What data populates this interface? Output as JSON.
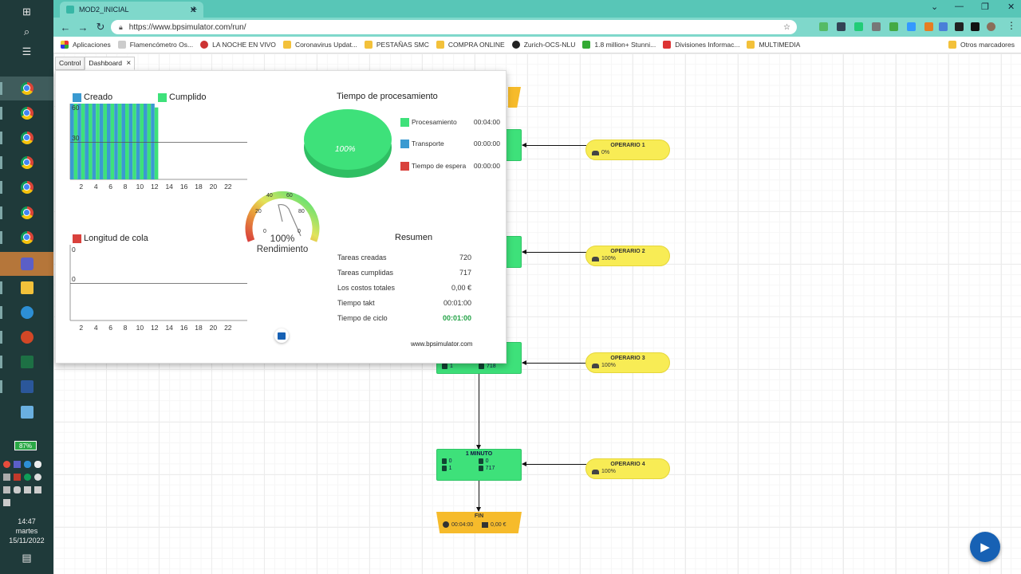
{
  "browser": {
    "tab_title": "MOD2_INICIAL",
    "url": "https://www.bpsimulator.com/run/",
    "bookmarks": [
      "Aplicaciones",
      "Flamencómetro Os...",
      "LA NOCHE EN VIVO",
      "Coronavirus Updat...",
      "PESTAÑAS SMC",
      "COMPRA ONLINE",
      "Zurich-OCS-NLU",
      "1.8 million+ Stunni...",
      "Divisiones Informac...",
      "MULTIMEDIA"
    ],
    "other_bookmarks": "Otros marcadores"
  },
  "taskbar": {
    "battery": "87%",
    "time": "14:47",
    "day": "martes",
    "date": "15/11/2022"
  },
  "dashboard": {
    "tabs": [
      "Control",
      "Dashboard"
    ],
    "close_glyph": "×",
    "tasks_chart": {
      "legend": [
        "Creado",
        "Cumplido"
      ],
      "y_ticks": [
        "60",
        "30"
      ],
      "x_ticks": [
        "2",
        "4",
        "6",
        "8",
        "10",
        "12",
        "14",
        "16",
        "18",
        "20",
        "22"
      ]
    },
    "queue_chart": {
      "legend": [
        "Longitud de cola"
      ],
      "y_ticks": [
        "0",
        "0"
      ],
      "x_ticks": [
        "2",
        "4",
        "6",
        "8",
        "10",
        "12",
        "14",
        "16",
        "18",
        "20",
        "22"
      ]
    },
    "gauge": {
      "ticks": [
        "0",
        "20",
        "40",
        "60",
        "80",
        "0"
      ],
      "value_text": "100%",
      "label": "Rendimiento"
    },
    "pie": {
      "title": "Tiempo de procesamiento",
      "center_label": "100%",
      "legend": [
        {
          "name": "Procesamiento",
          "value": "00:04:00",
          "color": "#3ee17a"
        },
        {
          "name": "Transporte",
          "value": "00:00:00",
          "color": "#3a9ad1"
        },
        {
          "name": "Tiempo de espera",
          "value": "00:00:00",
          "color": "#d9413c"
        }
      ]
    },
    "summary": {
      "title": "Resumen",
      "rows": [
        {
          "label": "Tareas creadas",
          "value": "720"
        },
        {
          "label": "Tareas cumplidas",
          "value": "717"
        },
        {
          "label": "Los costos totales",
          "value": "0,00 €"
        },
        {
          "label": "Tiempo takt",
          "value": "00:01:00"
        },
        {
          "label": "Tiempo de ciclo",
          "value": "00:01:00"
        }
      ]
    },
    "footer": "www.bpsimulator.com"
  },
  "diagram": {
    "operators": [
      {
        "name": "OPERARIO 1",
        "value": "0%"
      },
      {
        "name": "OPERARIO 2",
        "value": "100%"
      },
      {
        "name": "OPERARIO 3",
        "value": "100%"
      },
      {
        "name": "OPERARIO 4",
        "value": "100%"
      }
    ],
    "process3": {
      "v1": "1",
      "v2": "718"
    },
    "process4": {
      "title": "1 MINUTO",
      "v1": "0",
      "v2": "0",
      "v3": "1",
      "v4": "717"
    },
    "fin": {
      "title": "FIN",
      "time": "00:04:00",
      "cost": "0,00 €"
    }
  },
  "chart_data": [
    {
      "type": "bar",
      "categories": [
        "1",
        "2",
        "3",
        "4",
        "5",
        "6",
        "7",
        "8",
        "9",
        "10",
        "11",
        "12"
      ],
      "series": [
        {
          "name": "Creado",
          "values": [
            60,
            60,
            60,
            60,
            60,
            60,
            60,
            60,
            60,
            60,
            60,
            60
          ]
        },
        {
          "name": "Cumplido",
          "values": [
            60,
            60,
            60,
            60,
            60,
            60,
            60,
            60,
            60,
            60,
            60,
            57
          ]
        }
      ],
      "ylim": [
        0,
        60
      ],
      "legend": "top-left"
    },
    {
      "type": "line",
      "x": [
        1,
        2,
        3,
        4,
        5,
        6,
        7,
        8,
        9,
        10,
        11,
        12
      ],
      "series": [
        {
          "name": "Longitud de cola",
          "values": [
            0,
            0,
            0,
            0,
            0,
            0,
            0,
            0,
            0,
            0,
            0,
            0
          ]
        }
      ],
      "legend": "top-left"
    },
    {
      "type": "pie",
      "categories": [
        "Procesamiento",
        "Transporte",
        "Tiempo de espera"
      ],
      "values": [
        100,
        0,
        0
      ]
    }
  ],
  "colors": {
    "accent": "#58c6b7",
    "created": "#3a9ad1",
    "done": "#3ee17a",
    "queue": "#d9413c"
  }
}
